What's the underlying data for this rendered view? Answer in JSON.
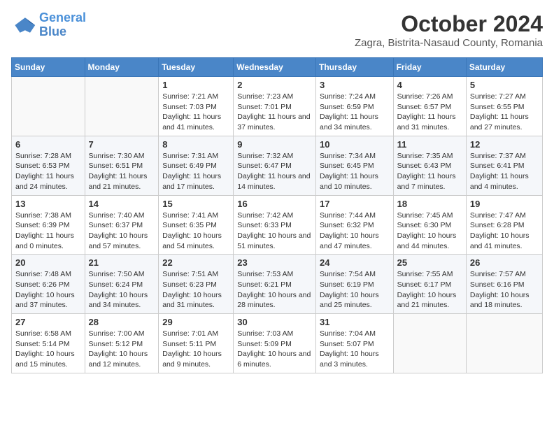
{
  "header": {
    "logo_line1": "General",
    "logo_line2": "Blue",
    "month": "October 2024",
    "location": "Zagra, Bistrita-Nasaud County, Romania"
  },
  "days_of_week": [
    "Sunday",
    "Monday",
    "Tuesday",
    "Wednesday",
    "Thursday",
    "Friday",
    "Saturday"
  ],
  "weeks": [
    [
      {
        "day": "",
        "info": ""
      },
      {
        "day": "",
        "info": ""
      },
      {
        "day": "1",
        "info": "Sunrise: 7:21 AM\nSunset: 7:03 PM\nDaylight: 11 hours and 41 minutes."
      },
      {
        "day": "2",
        "info": "Sunrise: 7:23 AM\nSunset: 7:01 PM\nDaylight: 11 hours and 37 minutes."
      },
      {
        "day": "3",
        "info": "Sunrise: 7:24 AM\nSunset: 6:59 PM\nDaylight: 11 hours and 34 minutes."
      },
      {
        "day": "4",
        "info": "Sunrise: 7:26 AM\nSunset: 6:57 PM\nDaylight: 11 hours and 31 minutes."
      },
      {
        "day": "5",
        "info": "Sunrise: 7:27 AM\nSunset: 6:55 PM\nDaylight: 11 hours and 27 minutes."
      }
    ],
    [
      {
        "day": "6",
        "info": "Sunrise: 7:28 AM\nSunset: 6:53 PM\nDaylight: 11 hours and 24 minutes."
      },
      {
        "day": "7",
        "info": "Sunrise: 7:30 AM\nSunset: 6:51 PM\nDaylight: 11 hours and 21 minutes."
      },
      {
        "day": "8",
        "info": "Sunrise: 7:31 AM\nSunset: 6:49 PM\nDaylight: 11 hours and 17 minutes."
      },
      {
        "day": "9",
        "info": "Sunrise: 7:32 AM\nSunset: 6:47 PM\nDaylight: 11 hours and 14 minutes."
      },
      {
        "day": "10",
        "info": "Sunrise: 7:34 AM\nSunset: 6:45 PM\nDaylight: 11 hours and 10 minutes."
      },
      {
        "day": "11",
        "info": "Sunrise: 7:35 AM\nSunset: 6:43 PM\nDaylight: 11 hours and 7 minutes."
      },
      {
        "day": "12",
        "info": "Sunrise: 7:37 AM\nSunset: 6:41 PM\nDaylight: 11 hours and 4 minutes."
      }
    ],
    [
      {
        "day": "13",
        "info": "Sunrise: 7:38 AM\nSunset: 6:39 PM\nDaylight: 11 hours and 0 minutes."
      },
      {
        "day": "14",
        "info": "Sunrise: 7:40 AM\nSunset: 6:37 PM\nDaylight: 10 hours and 57 minutes."
      },
      {
        "day": "15",
        "info": "Sunrise: 7:41 AM\nSunset: 6:35 PM\nDaylight: 10 hours and 54 minutes."
      },
      {
        "day": "16",
        "info": "Sunrise: 7:42 AM\nSunset: 6:33 PM\nDaylight: 10 hours and 51 minutes."
      },
      {
        "day": "17",
        "info": "Sunrise: 7:44 AM\nSunset: 6:32 PM\nDaylight: 10 hours and 47 minutes."
      },
      {
        "day": "18",
        "info": "Sunrise: 7:45 AM\nSunset: 6:30 PM\nDaylight: 10 hours and 44 minutes."
      },
      {
        "day": "19",
        "info": "Sunrise: 7:47 AM\nSunset: 6:28 PM\nDaylight: 10 hours and 41 minutes."
      }
    ],
    [
      {
        "day": "20",
        "info": "Sunrise: 7:48 AM\nSunset: 6:26 PM\nDaylight: 10 hours and 37 minutes."
      },
      {
        "day": "21",
        "info": "Sunrise: 7:50 AM\nSunset: 6:24 PM\nDaylight: 10 hours and 34 minutes."
      },
      {
        "day": "22",
        "info": "Sunrise: 7:51 AM\nSunset: 6:23 PM\nDaylight: 10 hours and 31 minutes."
      },
      {
        "day": "23",
        "info": "Sunrise: 7:53 AM\nSunset: 6:21 PM\nDaylight: 10 hours and 28 minutes."
      },
      {
        "day": "24",
        "info": "Sunrise: 7:54 AM\nSunset: 6:19 PM\nDaylight: 10 hours and 25 minutes."
      },
      {
        "day": "25",
        "info": "Sunrise: 7:55 AM\nSunset: 6:17 PM\nDaylight: 10 hours and 21 minutes."
      },
      {
        "day": "26",
        "info": "Sunrise: 7:57 AM\nSunset: 6:16 PM\nDaylight: 10 hours and 18 minutes."
      }
    ],
    [
      {
        "day": "27",
        "info": "Sunrise: 6:58 AM\nSunset: 5:14 PM\nDaylight: 10 hours and 15 minutes."
      },
      {
        "day": "28",
        "info": "Sunrise: 7:00 AM\nSunset: 5:12 PM\nDaylight: 10 hours and 12 minutes."
      },
      {
        "day": "29",
        "info": "Sunrise: 7:01 AM\nSunset: 5:11 PM\nDaylight: 10 hours and 9 minutes."
      },
      {
        "day": "30",
        "info": "Sunrise: 7:03 AM\nSunset: 5:09 PM\nDaylight: 10 hours and 6 minutes."
      },
      {
        "day": "31",
        "info": "Sunrise: 7:04 AM\nSunset: 5:07 PM\nDaylight: 10 hours and 3 minutes."
      },
      {
        "day": "",
        "info": ""
      },
      {
        "day": "",
        "info": ""
      }
    ]
  ]
}
